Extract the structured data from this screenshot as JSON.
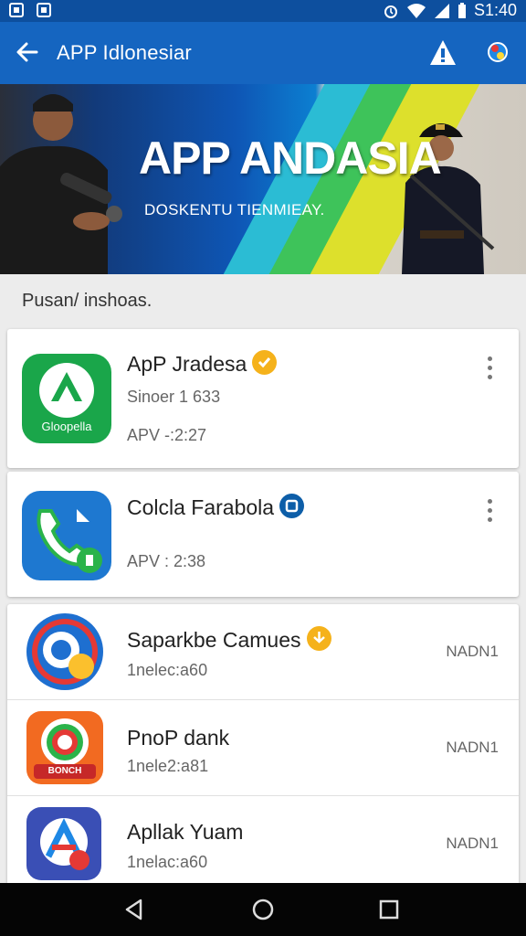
{
  "status_bar": {
    "time": "S1:40",
    "icons": [
      "image-icon",
      "photo-icon",
      "alarm-icon",
      "wifi-icon",
      "signal-icon",
      "battery-icon"
    ]
  },
  "app_bar": {
    "title": "APP Idlonesiar",
    "actions": [
      "alert-icon",
      "account-icon"
    ]
  },
  "banner": {
    "headline": "APP ANDASIA",
    "subline": "DOSKENTU TIENMIEAY."
  },
  "section": {
    "label": "Pusan/ inshoas."
  },
  "featured": [
    {
      "name": "ApP Jradesa",
      "sub1": "Sinoer 1 633",
      "sub2": "APV -:2:27",
      "icon_label": "Gloopella",
      "badge": "verified-badge-icon",
      "badge_color": "#f5b21b",
      "icon_color": "#1aa64a"
    },
    {
      "name": "Colcla Farabola",
      "sub1": "APV : 2:38",
      "badge": "square-badge-icon",
      "badge_color": "#0d5ea8",
      "icon_color": "#1e78d0"
    }
  ],
  "list": [
    {
      "name": "Saparkbe Camues",
      "sub": "1nelec:a60",
      "right": "NADN1",
      "badge": "download-badge-icon",
      "badge_color": "#f5b21b"
    },
    {
      "name": "PnoP dank",
      "sub": "1nele2:a81",
      "right": "NADN1",
      "icon_label": "BONCH"
    },
    {
      "name": "Apllak Yuam",
      "sub": "1nelac:a60",
      "right": "NADN1"
    }
  ],
  "nav": [
    "back-triangle-icon",
    "home-circle-icon",
    "recents-square-icon"
  ],
  "colors": {
    "status_bar": "#0d4f9e",
    "app_bar": "#1565c0",
    "background": "#ececec"
  }
}
